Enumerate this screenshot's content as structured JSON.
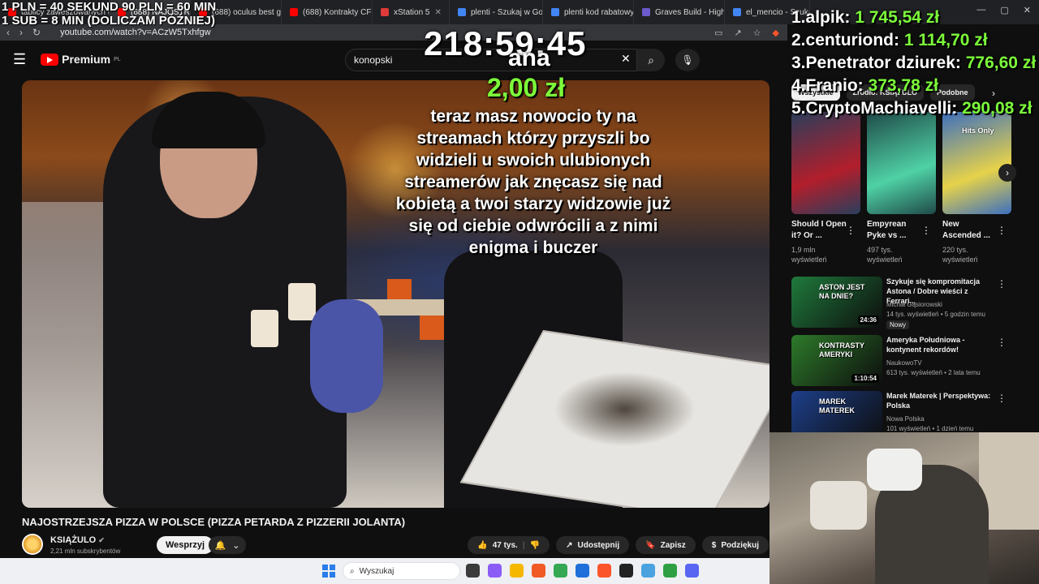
{
  "browser": {
    "tabs": [
      {
        "label": "tablicy zaweszowanych uk",
        "color": "#ff0000",
        "active": false
      },
      {
        "label": "(688) NAJOSTR",
        "color": "#ff0000",
        "active": true
      },
      {
        "label": "(688) oculus best gam",
        "color": "#ff0000",
        "active": false
      },
      {
        "label": "(688) Kontrakty CFD -",
        "color": "#ff0000",
        "active": false
      },
      {
        "label": "xStation 5",
        "color": "#e03a3a",
        "active": false
      },
      {
        "label": "plenti - Szukaj w Goog",
        "color": "#4285f4",
        "active": false
      },
      {
        "label": "plenti kod rabatowy -",
        "color": "#4285f4",
        "active": false
      },
      {
        "label": "Graves Build - Highe",
        "color": "#6a5acd",
        "active": false
      },
      {
        "label": "el_mencio - Szukaj",
        "color": "#4285f4",
        "active": false
      }
    ],
    "url": "youtube.com/watch?v=ACzW5Txhfgw"
  },
  "youtube": {
    "logo_text": "Premium",
    "logo_region": "PL",
    "search_value": "konopski",
    "video": {
      "title": "NAJOSTRZEJSZA PIZZA W POLSCE (PIZZA PETARDA Z PIZZERII JOLANTA)",
      "channel": "KSIĄŻULO",
      "subscribers": "2,21 mln subskrybentów",
      "support_label": "Wesprzyj",
      "likes": "47 tys.",
      "share_label": "Udostępnij",
      "save_label": "Zapisz",
      "thanks_label": "Podziękuj"
    },
    "chips": [
      "Wszystkie",
      "Źródło: KSIĄŻULO",
      "Podobne"
    ],
    "shorts": [
      {
        "title": "Should I Open it? Or ...",
        "views": "1,9 mln wyświetleń",
        "color": "#2a3e5c",
        "accent": "#b21e2b"
      },
      {
        "title": "Empyrean Pyke vs ...",
        "views": "497 tys. wyświetleń",
        "color": "#1f4a48",
        "accent": "#4fd1a5"
      },
      {
        "title": "New Ascended ...",
        "views": "220 tys. wyświetleń",
        "color": "#3c6fbf",
        "accent": "#e6d24a",
        "overlay": "Hits Only"
      }
    ],
    "recommended": [
      {
        "title": "Szykuje się kompromitacja Astona / Dobre wieści z Ferrari...",
        "channel": "Michał Gąsiorowski",
        "meta": "14 tys. wyświetleń • 5 godzin temu",
        "badge": "Nowy",
        "duration": "24:36",
        "color": "#1f7a3c",
        "thumb_text": "ASTON JEST NA DNIE?"
      },
      {
        "title": "Ameryka Południowa - kontynent rekordów!",
        "channel": "NaukowoTV",
        "meta": "613 tys. wyświetleń • 2 lata temu",
        "duration": "1:10:54",
        "color": "#2d7a2a",
        "thumb_text": "KONTRASTY AMERYKI"
      },
      {
        "title": "Marek Materek | Perspektywa: Polska",
        "channel": "Nowa Polska",
        "meta": "101 wyświetleń • 1 dzień temu",
        "color": "#1d3f8a",
        "thumb_text": "MAREK MATEREK"
      }
    ]
  },
  "stream_overlay": {
    "rate_line1": "1 PLN = 40 SEKUND 90 PLN = 60 MIN",
    "rate_line2": "1 SUB = 8 MIN (DOLICZAM PÓŹNIEJ)",
    "timer": "218:59:45",
    "donor": "ana",
    "amount": "2,00 zł",
    "message": "teraz masz nowocio ty na streamach którzy przyszli bo widzieli u swoich ulubionych streamerów jak znęcasz się nad kobietą a twoi starzy widzowie już się od ciebie odwrócili a z nimi enigma i buczer",
    "leaderboard": [
      {
        "rank": "1.",
        "name": "alpik:",
        "amount": "1 745,54 zł"
      },
      {
        "rank": "2.",
        "name": "centuriond:",
        "amount": "1 114,70 zł"
      },
      {
        "rank": "3.",
        "name": "Penetrator dziurek:",
        "amount": "776,60 zł"
      },
      {
        "rank": "4.",
        "name": "Franio:",
        "amount": "373,78 zł"
      },
      {
        "rank": "5.",
        "name": "CryptoMachiavelli:",
        "amount": "290,08 zł"
      }
    ]
  },
  "taskbar": {
    "search_placeholder": "Wyszukaj",
    "icons": [
      "#3b3b3b",
      "#8b5cf6",
      "#f5b700",
      "#f15a24",
      "#34a853",
      "#1e6fd9",
      "#fb542b",
      "#222222",
      "#4aa3df",
      "#2ea043",
      "#5865f2"
    ]
  },
  "colors": {
    "youtube_red": "#ff0000",
    "donation_green": "#7cfc3a"
  }
}
